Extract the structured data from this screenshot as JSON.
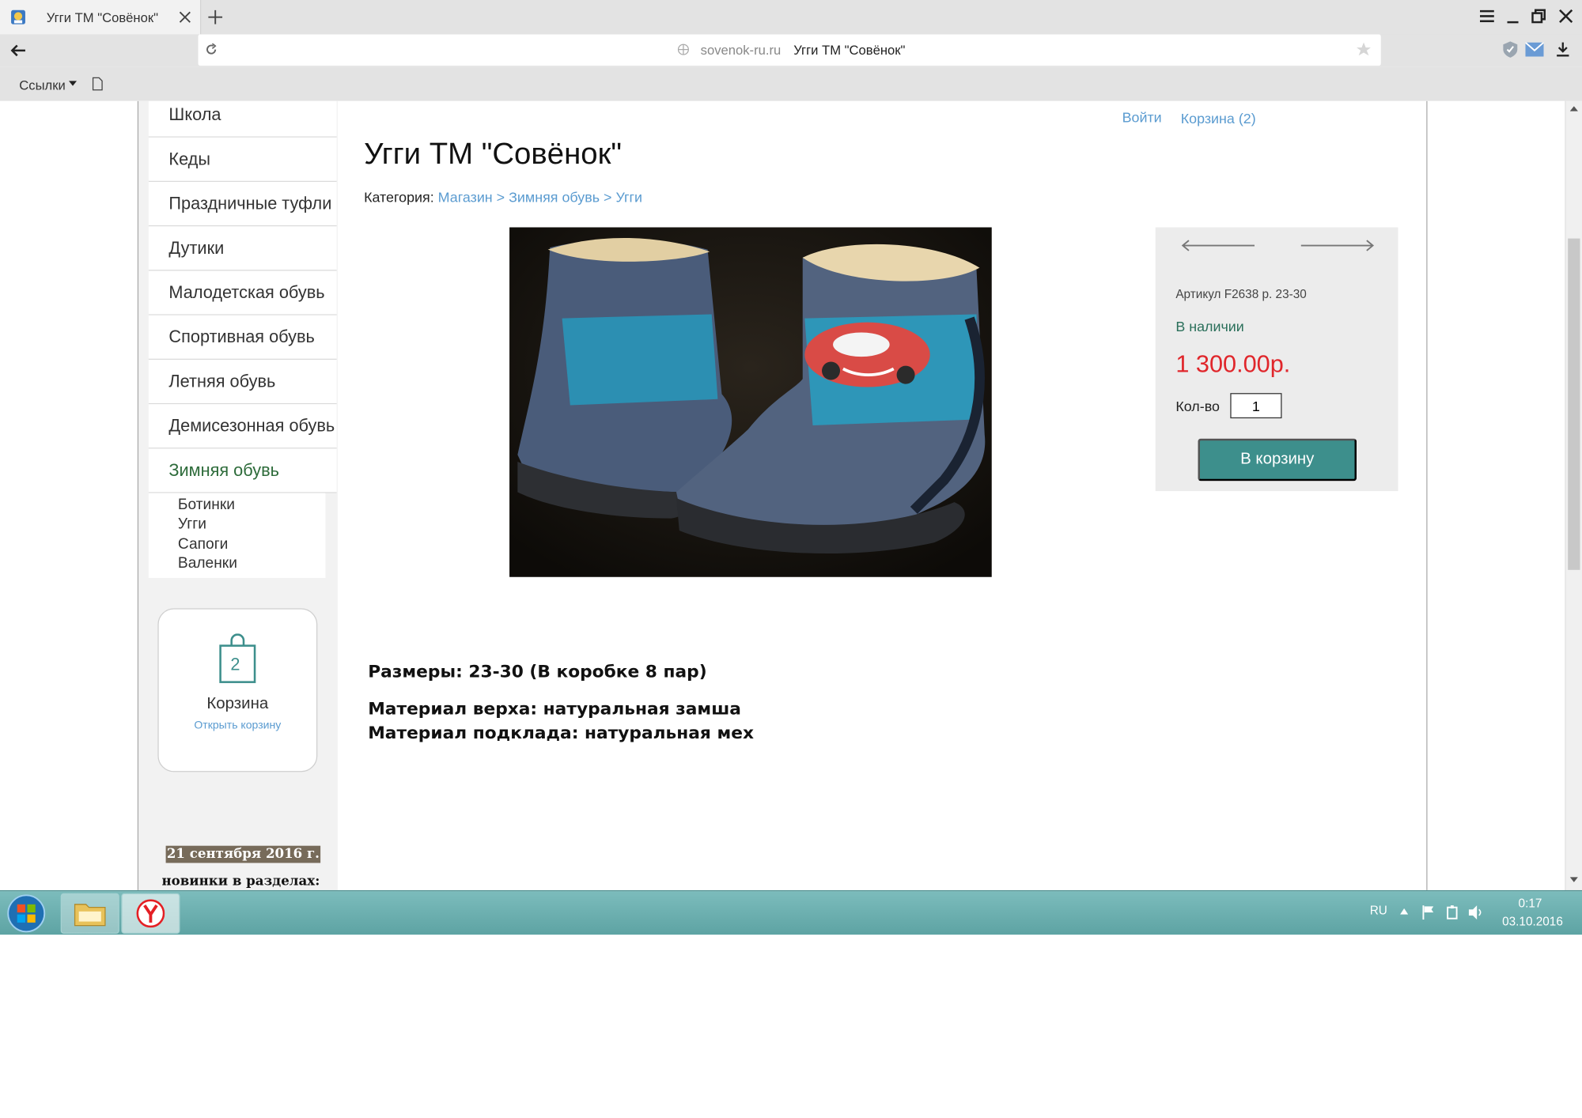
{
  "browser": {
    "tab_title": "Угги ТМ \"Совёнок\"",
    "url_domain": "sovenok-ru.ru",
    "url_title": "Угги ТМ \"Совёнок\"",
    "bookmarks_label": "Ссылки"
  },
  "header": {
    "login": "Войти",
    "cart": "Корзина (2)"
  },
  "product": {
    "title": "Угги ТМ \"Совёнок\"",
    "category_label": "Категория:",
    "breadcrumb": [
      "Магазин",
      ">",
      "Зимняя обувь",
      ">",
      "Угги"
    ],
    "sku": "Артикул F2638 р. 23-30",
    "availability": "В наличии",
    "price": "1 300.00р.",
    "qty_label": "Кол-во",
    "qty_value": "1",
    "buy_label": "В корзину",
    "sizes": "Размеры: 23-30 (В коробке 8 пар)",
    "material_top": "Материал верха: натуральная замша",
    "material_lining": "Материал подклада: натуральная мех"
  },
  "sidebar": {
    "items": [
      {
        "label": "Школа"
      },
      {
        "label": "Кеды"
      },
      {
        "label": "Праздничные туфли"
      },
      {
        "label": "Дутики"
      },
      {
        "label": "Малодетская обувь"
      },
      {
        "label": "Спортивная обувь"
      },
      {
        "label": "Летняя обувь"
      },
      {
        "label": "Демисезонная обувь"
      },
      {
        "label": "Зимняя обувь"
      }
    ],
    "subitems": [
      {
        "label": "Ботинки"
      },
      {
        "label": "Угги"
      },
      {
        "label": "Сапоги"
      },
      {
        "label": "Валенки"
      }
    ],
    "cart_widget": {
      "count": "2",
      "title": "Корзина",
      "link": "Открыть корзину"
    },
    "news_date": "21 сентября 2016 г.",
    "news_text": "новинки в разделах:"
  },
  "taskbar": {
    "lang": "RU",
    "time": "0:17",
    "date": "03.10.2016"
  },
  "colors": {
    "accent": "#3d8f8c",
    "price": "#e0262b",
    "link": "#5a9bd0",
    "available": "#2a6f5a"
  }
}
